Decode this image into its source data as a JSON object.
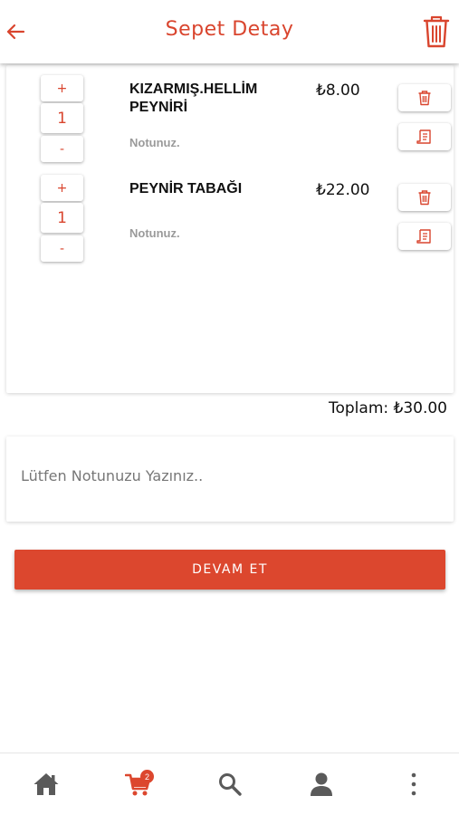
{
  "header": {
    "title": "Sepet Detay",
    "back_icon": "arrow-left-icon",
    "clear_icon": "trash-icon"
  },
  "cart": {
    "items": [
      {
        "name": "KIZARMIŞ.HELLİM PEYNİRİ",
        "price": "₺8.00",
        "quantity": "1",
        "note_label": "Notunuz.",
        "plus_label": "+",
        "minus_label": "-"
      },
      {
        "name": "PEYNİR TABAĞI",
        "price": "₺22.00",
        "quantity": "1",
        "note_label": "Notunuz.",
        "plus_label": "+",
        "minus_label": "-"
      }
    ]
  },
  "total": {
    "text": "Toplam: ₺30.00"
  },
  "order_note": {
    "placeholder": "Lütfen Notunuzu Yazınız..",
    "value": ""
  },
  "continue_button": {
    "label": "DEVAM ET"
  },
  "bottom_nav": {
    "items": [
      "home-icon",
      "cart-icon",
      "search-icon",
      "user-icon",
      "more-vertical-icon"
    ],
    "cart_badge": "2"
  },
  "colors": {
    "accent": "#dc472e",
    "icon_gray": "#5a5a5a"
  }
}
